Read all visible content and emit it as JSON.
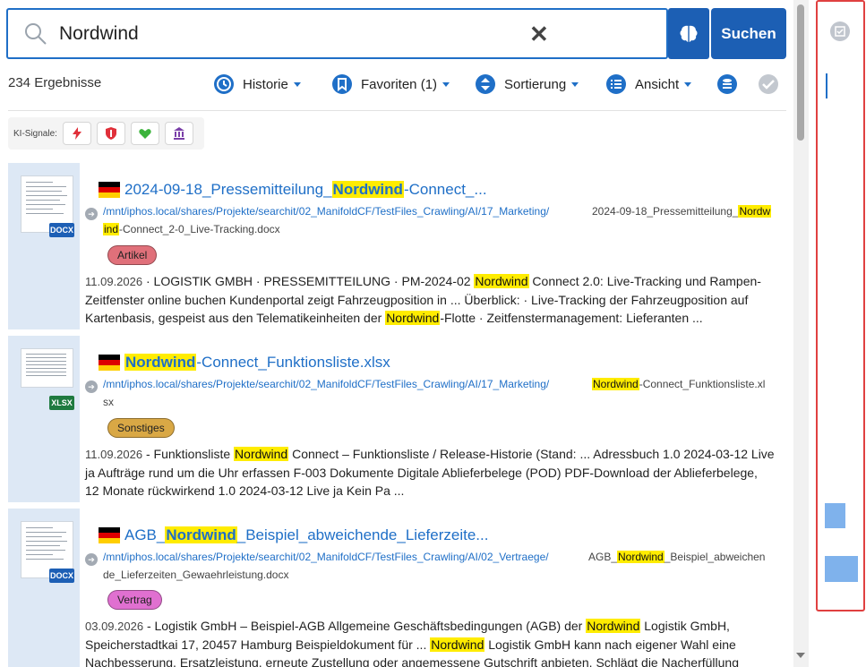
{
  "search": {
    "query": "Nordwind",
    "submit_label": "Suchen"
  },
  "toolbar": {
    "result_count": "234 Ergebnisse",
    "history_label": "Historie",
    "favorites_label": "Favoriten (1)",
    "sort_label": "Sortierung",
    "view_label": "Ansicht"
  },
  "signals": {
    "label": "KI-Signale:"
  },
  "colors": {
    "accent": "#1f6fc7",
    "highlight": "#ffec00",
    "badge_artikel": "#e0707a",
    "badge_sonstiges": "#d9a845",
    "badge_vertrag": "#e070d0",
    "docx": "#1d5fb5",
    "xlsx": "#1f7a3f"
  },
  "results": [
    {
      "type_label": "DOCX",
      "title_pre": "2024-09-18_Pressemitteilung_",
      "title_hl": "Nordwind",
      "title_post": "-Connect_...",
      "path": "/mnt/iphos.local/shares/Projekte/searchit/02_ManifoldCF/TestFiles_Crawling/AI/17_Marketing/",
      "path2_hl": "ind",
      "path2_post": "-Connect_2-0_Live-Tracking.docx",
      "name_pre": "2024-09-18_Pressemitteilung_",
      "name_hl": "Nordw",
      "name_post": "",
      "badge": "Artikel",
      "date": "11.09.2026",
      "s1": " · LOGISTIK GMBH · PRESSEMITTEILUNG · PM-2024-02 ",
      "h1": "Nordwind",
      "s2": " Connect 2.0: Live-Tracking und Rampen-Zeitfenster online buchen Kundenportal zeigt Fahrzeugposition in ... Überblick: · Live-Tracking der Fahrzeugposition auf Kartenbasis, gespeist aus den Telematikeinheiten der ",
      "h2": "Nordwind",
      "s3": "-Flotte · Zeitfenstermanagement: Lieferanten ..."
    },
    {
      "type_label": "XLSX",
      "title_pre": "",
      "title_hl": "Nordwind",
      "title_post": "-Connect_Funktionsliste.xlsx",
      "path": "/mnt/iphos.local/shares/Projekte/searchit/02_ManifoldCF/TestFiles_Crawling/AI/17_Marketing/",
      "path2_hl": "",
      "path2_post": "sx",
      "name_pre": "",
      "name_hl": "Nordwind",
      "name_post": "-Connect_Funktionsliste.xl",
      "badge": "Sonstiges",
      "date": "11.09.2026",
      "s1": " - Funktionsliste ",
      "h1": "Nordwind",
      "s2": " Connect – Funktionsliste / Release-Historie (Stand: ... Adressbuch 1.0 2024-03-12 Live ja Aufträge rund um die Uhr erfassen F-003 Dokumente Digitale Ablieferbelege (POD) PDF-Download der Ablieferbelege, 12 Monate rückwirkend 1.0 2024-03-12 Live ja Kein Pa ...",
      "h2": "",
      "s3": ""
    },
    {
      "type_label": "DOCX",
      "title_pre": "AGB_",
      "title_hl": "Nordwind",
      "title_post": "_Beispiel_abweichende_Lieferzeite...",
      "path": "/mnt/iphos.local/shares/Projekte/searchit/02_ManifoldCF/TestFiles_Crawling/AI/02_Vertraege/",
      "path2_hl": "",
      "path2_post": "de_Lieferzeiten_Gewaehrleistung.docx",
      "name_pre": "AGB_",
      "name_hl": "Nordwind",
      "name_post": "_Beispiel_abweichen",
      "badge": "Vertrag",
      "date": "03.09.2026",
      "s1": " - Logistik GmbH – Beispiel-AGB Allgemeine Geschäftsbedingungen (AGB) der ",
      "h1": "Nordwind",
      "s2": " Logistik GmbH, Speicherstadtkai 17, 20457 Hamburg Beispieldokument für ... ",
      "h2": "Nordwind",
      "s3": " Logistik GmbH kann nach eigener Wahl eine Nachbesserung, Ersatzleistung, erneute Zustellung oder angemessene Gutschrift anbieten. Schlägt die Nacherfüllung"
    }
  ]
}
